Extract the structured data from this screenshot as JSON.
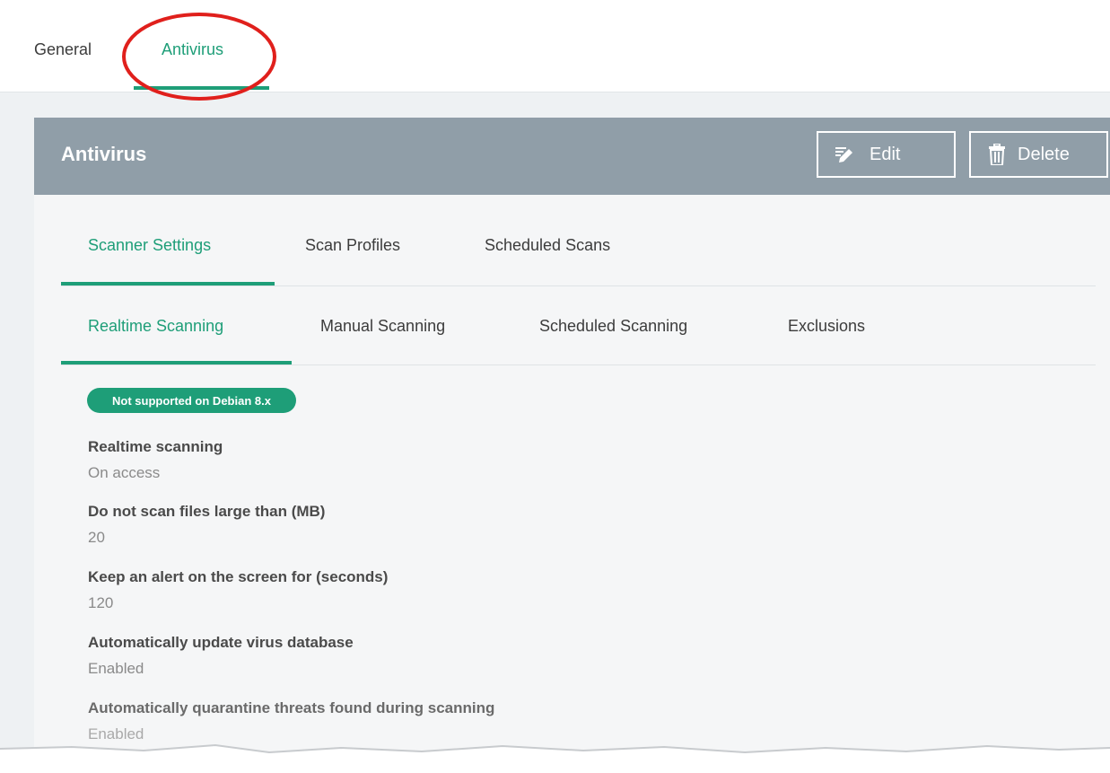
{
  "top_tabs": [
    {
      "label": "General",
      "active": false
    },
    {
      "label": "Antivirus",
      "active": true
    }
  ],
  "panel": {
    "title": "Antivirus",
    "buttons": {
      "edit": "Edit",
      "delete": "Delete"
    }
  },
  "sub_tabs": [
    {
      "label": "Scanner Settings",
      "active": true
    },
    {
      "label": "Scan Profiles",
      "active": false
    },
    {
      "label": "Scheduled Scans",
      "active": false
    }
  ],
  "scan_tabs": [
    {
      "label": "Realtime Scanning",
      "active": true
    },
    {
      "label": "Manual Scanning",
      "active": false
    },
    {
      "label": "Scheduled Scanning",
      "active": false
    },
    {
      "label": "Exclusions",
      "active": false
    }
  ],
  "badge": "Not supported on Debian 8.x",
  "settings": [
    {
      "label": "Realtime scanning",
      "value": "On access"
    },
    {
      "label": "Do not scan files large than (MB)",
      "value": "20"
    },
    {
      "label": "Keep an alert on the screen for (seconds)",
      "value": "120"
    },
    {
      "label": "Automatically update virus database",
      "value": "Enabled"
    },
    {
      "label": "Automatically quarantine threats found during scanning",
      "value": "Enabled"
    }
  ],
  "colors": {
    "accent": "#1e9e78",
    "header": "#909ea8",
    "highlight": "#e0201c"
  },
  "icons": [
    "edit-icon",
    "trash-icon"
  ]
}
